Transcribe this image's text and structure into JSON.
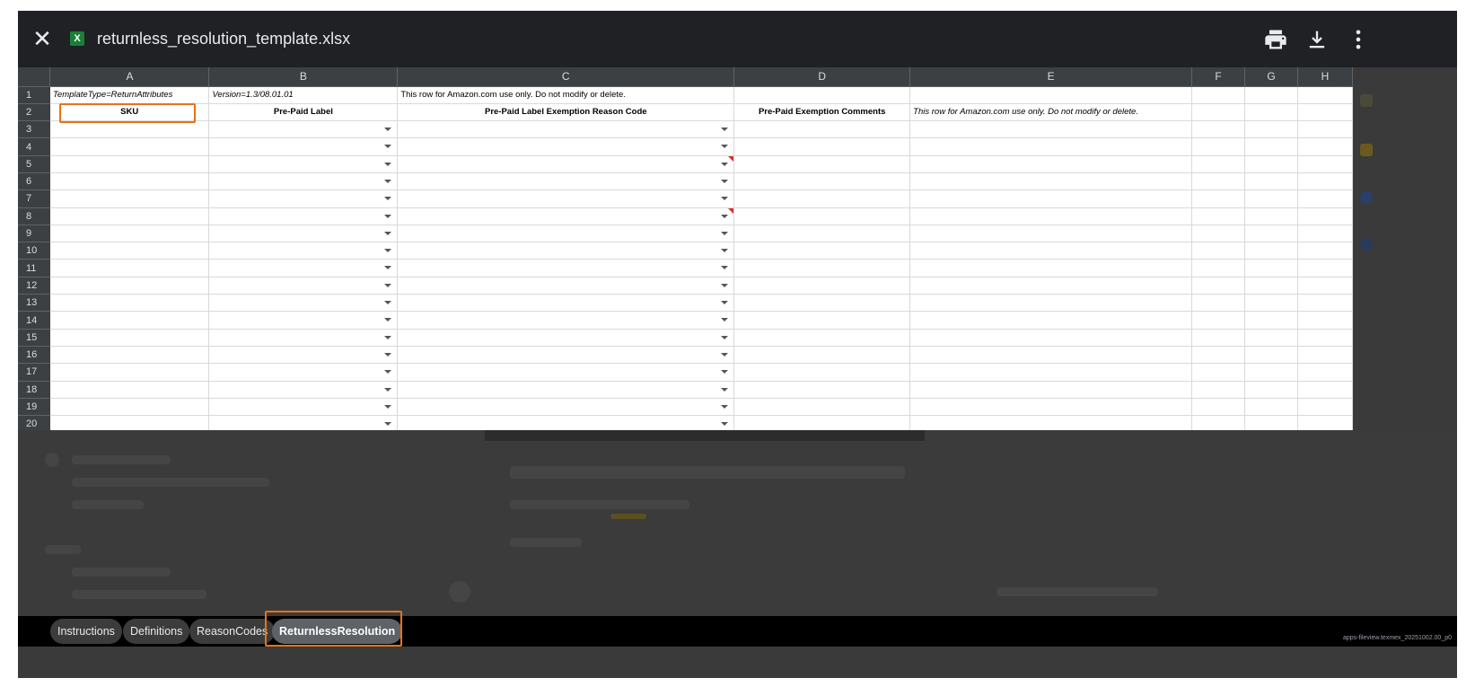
{
  "viewer": {
    "title": "returnless_resolution_template.xlsx",
    "file_icon": "X",
    "close_icon": "✕",
    "print_icon": "print-icon",
    "download_icon": "download-icon",
    "more_icon": "more-vert-icon"
  },
  "sheet": {
    "columns": [
      "A",
      "B",
      "C",
      "D",
      "E",
      "F",
      "G",
      "H"
    ],
    "rows": [
      "1",
      "2",
      "3",
      "4",
      "5",
      "6",
      "7",
      "8",
      "9",
      "10",
      "11",
      "12",
      "13",
      "14",
      "15",
      "16",
      "17",
      "18",
      "19",
      "20"
    ],
    "row1": {
      "A": "TemplateType=ReturnAttributes",
      "B": "Version=1.3/08.01.01",
      "C": "This row for Amazon.com use only.  Do not modify or delete."
    },
    "row2": {
      "A": "SKU",
      "B": "Pre-Paid Label",
      "C": "Pre-Paid Label Exemption Reason Code",
      "D": "Pre-Paid Exemption Comments",
      "E": "This row for Amazon.com use only.  Do not modify or delete."
    }
  },
  "tabs": [
    {
      "label": "Instructions"
    },
    {
      "label": "Definitions"
    },
    {
      "label": "ReasonCodes"
    },
    {
      "label": "ReturnlessResolution"
    }
  ],
  "active_tab": "ReturnlessResolution",
  "footer": "apps-fileview.texmex_20251002.00_p0",
  "colors": {
    "accent_highlight": "#e8711a",
    "excel_green": "#188038",
    "note_red": "#d93025"
  }
}
